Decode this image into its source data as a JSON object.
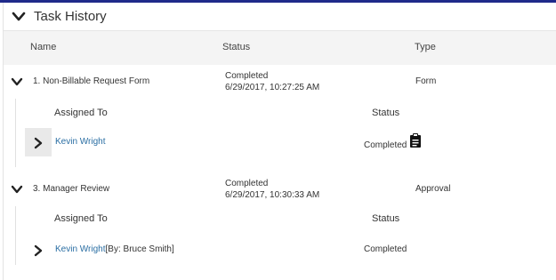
{
  "panel": {
    "title": "Task History"
  },
  "columns": {
    "name": "Name",
    "status": "Status",
    "type": "Type"
  },
  "tasks": [
    {
      "name": "1. Non-Billable Request Form",
      "status": "Completed",
      "date": "6/29/2017, 10:27:25 AM",
      "type": "Form",
      "assignments_header": {
        "assigned_to": "Assigned To",
        "status": "Status"
      },
      "assignments": [
        {
          "person": "Kevin Wright",
          "by": "",
          "status": "Completed",
          "icon": "clipboard-icon"
        }
      ]
    },
    {
      "name": "3. Manager Review",
      "status": "Completed",
      "date": "6/29/2017, 10:30:33 AM",
      "type": "Approval",
      "assignments_header": {
        "assigned_to": "Assigned To",
        "status": "Status"
      },
      "assignments": [
        {
          "person": "Kevin Wright",
          "by": "[By: Bruce Smith]",
          "status": "Completed",
          "icon": ""
        }
      ]
    }
  ],
  "colors": {
    "accent_bar": "#1f2a8a",
    "link": "#2a6ea3",
    "header_bg": "#f4f4f4"
  }
}
